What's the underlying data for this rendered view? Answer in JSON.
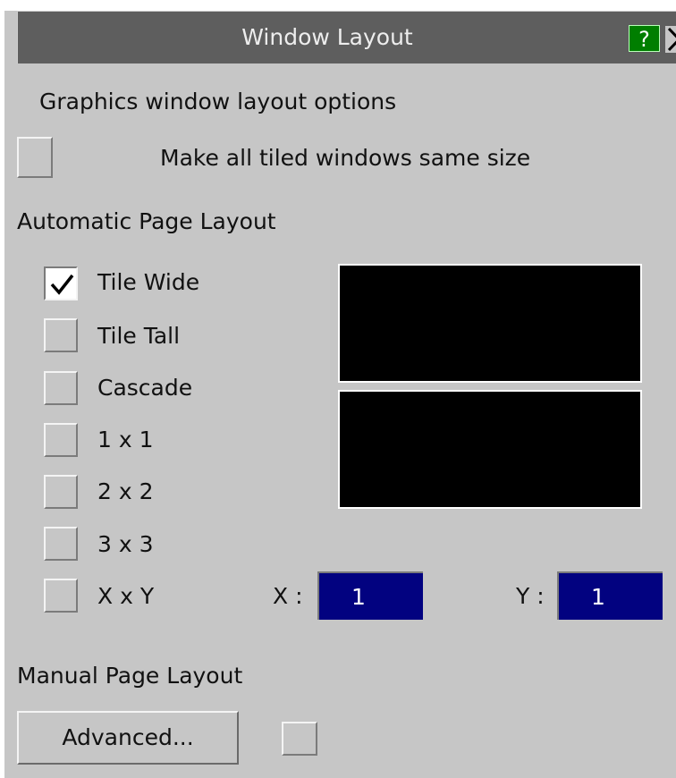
{
  "dialog": {
    "title": "Window Layout",
    "help_label": "?",
    "subtitle": "Graphics window layout options",
    "same_size_label": "Make all tiled windows same size",
    "same_size_checked": false
  },
  "automatic": {
    "heading": "Automatic Page Layout",
    "options": [
      {
        "label": "Tile Wide",
        "checked": true
      },
      {
        "label": "Tile Tall",
        "checked": false
      },
      {
        "label": "Cascade",
        "checked": false
      },
      {
        "label": "1 x 1",
        "checked": false
      },
      {
        "label": "2 x 2",
        "checked": false
      },
      {
        "label": "3 x 3",
        "checked": false
      },
      {
        "label": "X x Y",
        "checked": false
      }
    ],
    "x_label": "X :",
    "x_value": "1",
    "y_label": "Y :",
    "y_value": "1"
  },
  "manual": {
    "heading": "Manual Page Layout",
    "advanced_label": "Advanced...",
    "extra_checked": false
  },
  "colors": {
    "titlebar": "#5e5e5e",
    "help": "#007e00",
    "field": "#020280",
    "panel": "#c6c6c6"
  }
}
